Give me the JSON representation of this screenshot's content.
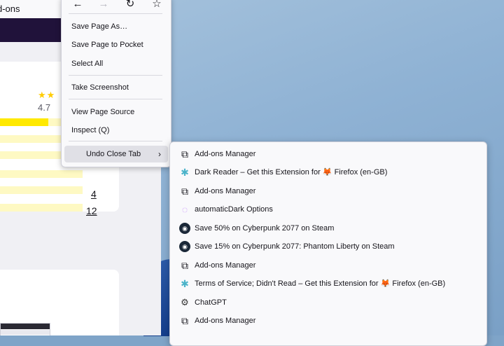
{
  "browser": {
    "tab_title": "d-ons",
    "rating_stars": "★★",
    "rating_value": "4.7",
    "rating_bars": [
      {
        "fill": 0.62
      },
      {
        "fill": 0.0
      },
      {
        "fill": 0.0
      },
      {
        "fill": 0.0
      },
      {
        "fill": 0.0
      },
      {
        "fill": 0.0
      }
    ],
    "counts": [
      "4",
      "12"
    ]
  },
  "context_menu": {
    "nav": {
      "back_icon": "←",
      "forward_icon": "→",
      "reload_icon": "↻",
      "bookmark_icon": "☆"
    },
    "items": [
      {
        "label": "Save Page As…"
      },
      {
        "label": "Save Page to Pocket"
      },
      {
        "label": "Select All"
      },
      {
        "label": "Take Screenshot"
      },
      {
        "label": "View Page Source"
      },
      {
        "label": "Inspect (Q)"
      },
      {
        "label": "Undo Close Tab",
        "arrow": "›"
      }
    ]
  },
  "undo_close_tab_submenu": {
    "items": [
      {
        "icon": "puzzle-icon",
        "glyph": "⧉",
        "label": "Add-ons Manager"
      },
      {
        "icon": "dark-reader-icon",
        "glyph": "✱",
        "label": "Dark Reader – Get this Extension for",
        "fox": "🦊",
        "suffix": "Firefox (en-GB)"
      },
      {
        "icon": "puzzle-icon",
        "glyph": "⧉",
        "label": "Add-ons Manager"
      },
      {
        "icon": "automaticdark-icon",
        "glyph": "◌",
        "label": "automaticDark Options"
      },
      {
        "icon": "steam-icon",
        "glyph": "◉",
        "label": "Save 50% on Cyberpunk 2077 on Steam"
      },
      {
        "icon": "steam-icon",
        "glyph": "◉",
        "label": "Save 15% on Cyberpunk 2077: Phantom Liberty on Steam"
      },
      {
        "icon": "puzzle-icon",
        "glyph": "⧉",
        "label": "Add-ons Manager"
      },
      {
        "icon": "tosdr-icon",
        "glyph": "✱",
        "label": "Terms of Service; Didn't Read – Get this Extension for",
        "fox": "🦊",
        "suffix": "Firefox (en-GB)"
      },
      {
        "icon": "chatgpt-icon",
        "glyph": "⚙",
        "label": "ChatGPT"
      },
      {
        "icon": "puzzle-icon",
        "glyph": "⧉",
        "label": "Add-ons Manager"
      }
    ]
  },
  "colors": {
    "menu_bg": "#f9f9fb",
    "menu_hover": "#e0e0e6",
    "rating_bar": "#ffe900",
    "site_header": "#20123a"
  }
}
